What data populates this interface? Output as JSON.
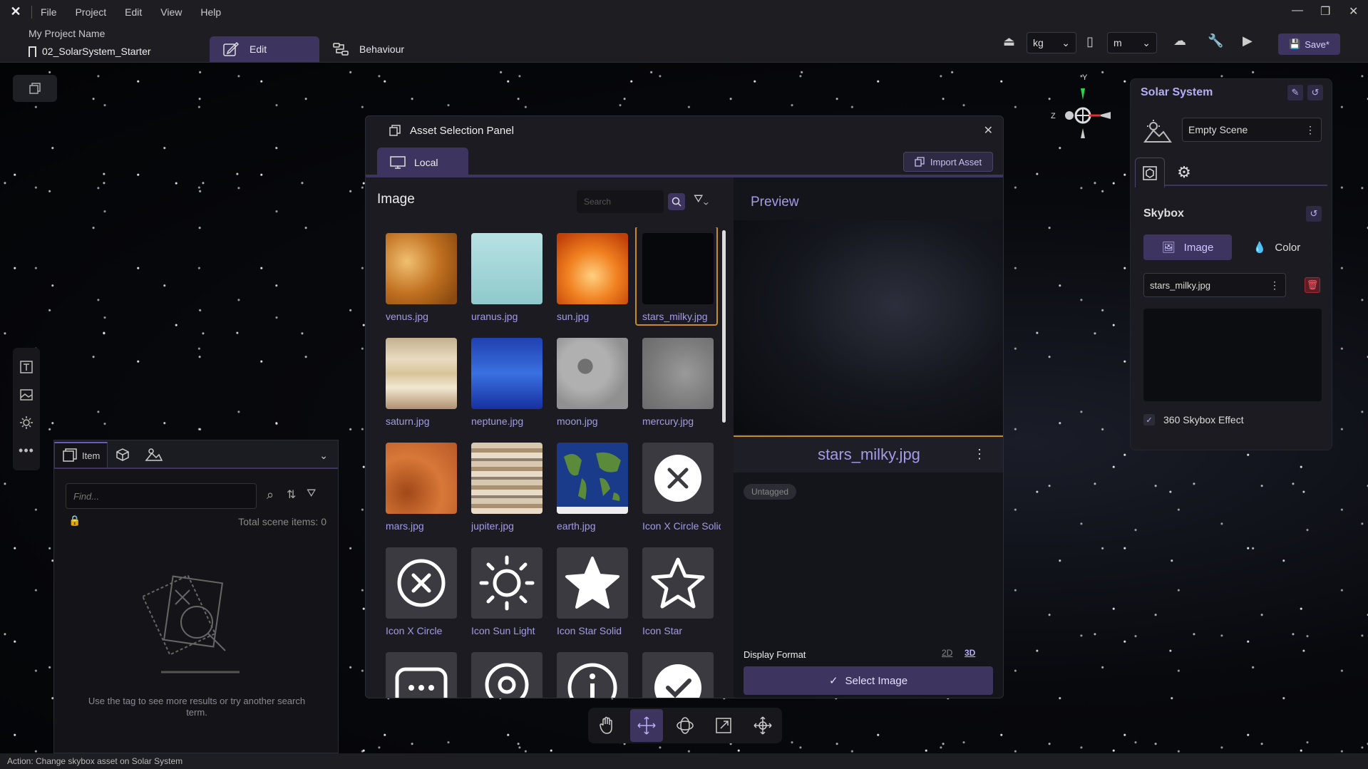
{
  "menu": {
    "items": [
      "File",
      "Project",
      "Edit",
      "View",
      "Help"
    ]
  },
  "project": {
    "name": "My Project Name",
    "scene_file": "02_SolarSystem_Starter"
  },
  "mode_tabs": {
    "edit": "Edit",
    "behaviour": "Behaviour"
  },
  "units": {
    "mass": "kg",
    "length": "m"
  },
  "save_label": "Save*",
  "items_panel": {
    "tab_item": "Item",
    "find_placeholder": "Find...",
    "total_label": "Total scene items: 0",
    "empty_message": "Use the tag to see more results or try another search term."
  },
  "asset_panel": {
    "title": "Asset Selection Panel",
    "tab_local": "Local",
    "import_label": "Import Asset",
    "section_title": "Image",
    "search_placeholder": "Search",
    "assets": [
      {
        "label": "venus.jpg",
        "icon": "venus-texture"
      },
      {
        "label": "uranus.jpg",
        "icon": "uranus-texture"
      },
      {
        "label": "sun.jpg",
        "icon": "sun-texture"
      },
      {
        "label": "stars_milky.jpg",
        "icon": "stars-texture",
        "selected": true
      },
      {
        "label": "saturn.jpg",
        "icon": "saturn-texture"
      },
      {
        "label": "neptune.jpg",
        "icon": "neptune-texture"
      },
      {
        "label": "moon.jpg",
        "icon": "moon-texture"
      },
      {
        "label": "mercury.jpg",
        "icon": "mercury-texture"
      },
      {
        "label": "mars.jpg",
        "icon": "mars-texture"
      },
      {
        "label": "jupiter.jpg",
        "icon": "jupiter-texture"
      },
      {
        "label": "earth.jpg",
        "icon": "earth-texture"
      },
      {
        "label": "Icon X Circle Solid",
        "icon": "x-circle-solid-icon"
      },
      {
        "label": "Icon X Circle",
        "icon": "x-circle-icon"
      },
      {
        "label": "Icon Sun Light",
        "icon": "sun-light-icon"
      },
      {
        "label": "Icon Star Solid",
        "icon": "star-solid-icon"
      },
      {
        "label": "Icon Star",
        "icon": "star-icon"
      },
      {
        "label": "",
        "icon": "chat-dots-icon"
      },
      {
        "label": "",
        "icon": "location-icon"
      },
      {
        "label": "",
        "icon": "info-icon"
      },
      {
        "label": "",
        "icon": "check-circle-icon"
      }
    ],
    "preview_title": "Preview",
    "preview_name": "stars_milky.jpg",
    "tag": "Untagged",
    "display_format": "Display Format",
    "fmt_2d": "2D",
    "fmt_3d": "3D",
    "select_label": "Select Image"
  },
  "gizmo": {
    "y": "Y",
    "z": "Z"
  },
  "properties": {
    "title": "Solar System",
    "scene_template": "Empty Scene",
    "skybox_title": "Skybox",
    "mode_image": "Image",
    "mode_color": "Color",
    "asset": "stars_milky.jpg",
    "effect_360": "360 Skybox Effect"
  },
  "status": "Action: Change skybox asset on Solar System"
}
